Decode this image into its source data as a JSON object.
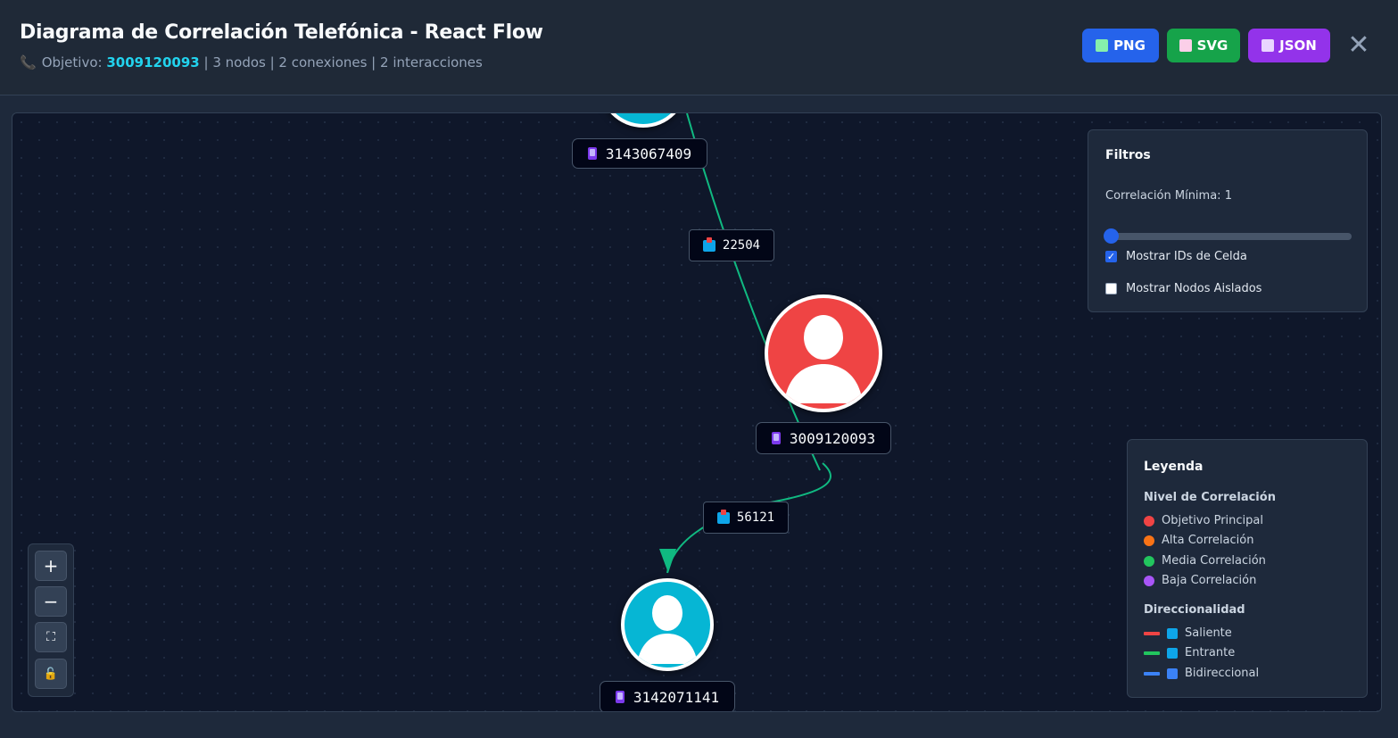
{
  "header": {
    "title": "Diagrama de Correlación Telefónica - React Flow",
    "objective_label": "Objetivo:",
    "objective_value": "3009120093",
    "summary": "| 3 nodos | 2 conexiones | 2 interacciones",
    "buttons": {
      "png": "PNG",
      "svg": "SVG",
      "json": "JSON"
    },
    "close": "✕"
  },
  "graph": {
    "nodes": [
      {
        "id": "3143067409",
        "label": "3143067409",
        "color": "#06b6d4"
      },
      {
        "id": "3009120093",
        "label": "3009120093",
        "color": "#ef4444"
      },
      {
        "id": "3142071141",
        "label": "3142071141",
        "color": "#06b6d4"
      }
    ],
    "edges": [
      {
        "label": "22504",
        "color": "#10b981"
      },
      {
        "label": "56121",
        "color": "#10b981"
      }
    ]
  },
  "filters": {
    "title": "Filtros",
    "min_correlation_label": "Correlación Mínima: 1",
    "min_correlation_value": 1,
    "show_cell_ids": {
      "label": "Mostrar IDs de Celda",
      "checked": true
    },
    "show_isolated": {
      "label": "Mostrar Nodos Aislados",
      "checked": false
    }
  },
  "legend": {
    "title": "Leyenda",
    "level_title": "Nivel de Correlación",
    "levels": [
      {
        "label": "Objetivo Principal",
        "color": "#ef4444"
      },
      {
        "label": "Alta Correlación",
        "color": "#f97316"
      },
      {
        "label": "Media Correlación",
        "color": "#22c55e"
      },
      {
        "label": "Baja Correlación",
        "color": "#a855f7"
      }
    ],
    "direction_title": "Direccionalidad",
    "directions": [
      {
        "label": "Saliente",
        "color": "#ef4444"
      },
      {
        "label": "Entrante",
        "color": "#22c55e"
      },
      {
        "label": "Bidireccional",
        "color": "#3b82f6"
      }
    ]
  },
  "controls": {
    "zoom_in": "+",
    "zoom_out": "−",
    "fit": "⛶",
    "lock": "🔓"
  }
}
